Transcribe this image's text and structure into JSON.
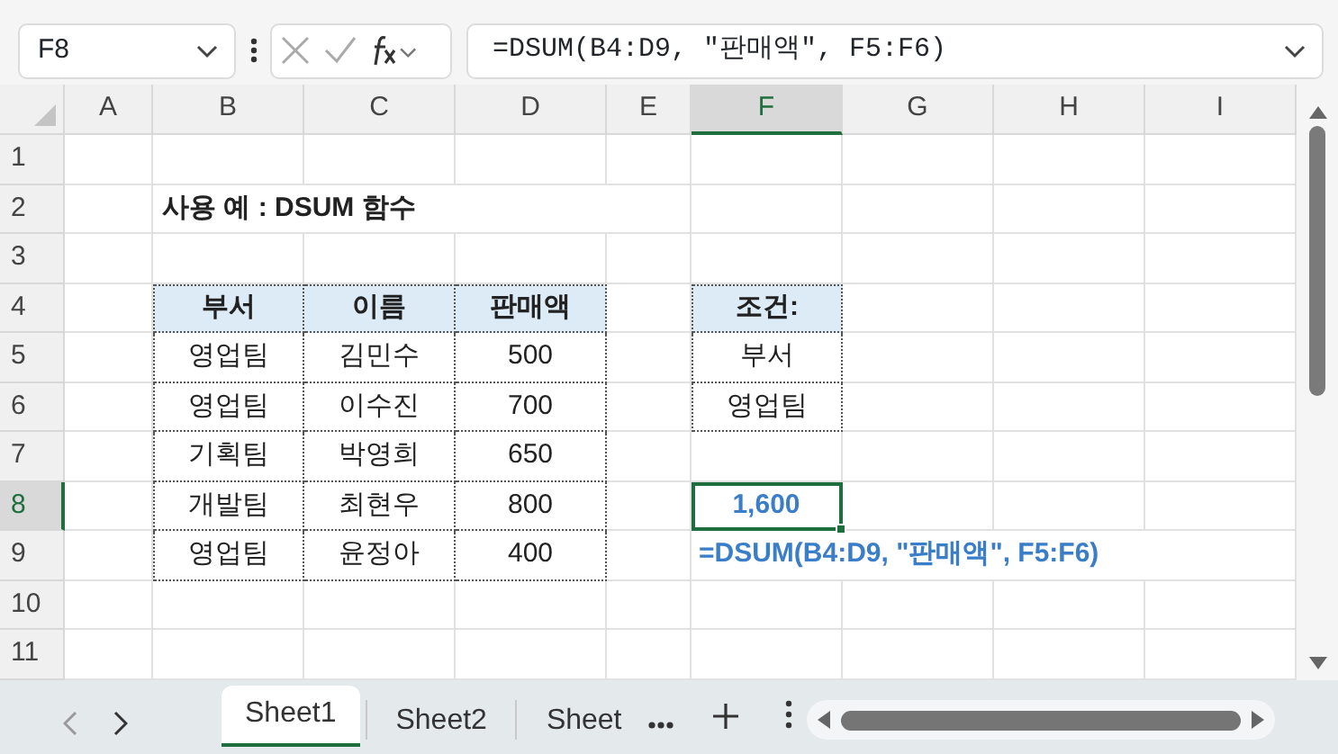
{
  "name_box": {
    "value": "F8"
  },
  "formula_bar": {
    "value": "=DSUM(B4:D9, \"판매액\", F5:F6)"
  },
  "columns": [
    {
      "label": "A",
      "selected": false
    },
    {
      "label": "B",
      "selected": false
    },
    {
      "label": "C",
      "selected": false
    },
    {
      "label": "D",
      "selected": false
    },
    {
      "label": "E",
      "selected": false
    },
    {
      "label": "F",
      "selected": true
    },
    {
      "label": "G",
      "selected": false
    },
    {
      "label": "H",
      "selected": false
    },
    {
      "label": "I",
      "selected": false
    }
  ],
  "rows": [
    {
      "label": "1",
      "selected": false
    },
    {
      "label": "2",
      "selected": false
    },
    {
      "label": "3",
      "selected": false
    },
    {
      "label": "4",
      "selected": false
    },
    {
      "label": "5",
      "selected": false
    },
    {
      "label": "6",
      "selected": false
    },
    {
      "label": "7",
      "selected": false
    },
    {
      "label": "8",
      "selected": true
    },
    {
      "label": "9",
      "selected": false
    },
    {
      "label": "10",
      "selected": false
    },
    {
      "label": "11",
      "selected": false
    }
  ],
  "title": "사용 예 : DSUM 함수",
  "sales_table": {
    "columns": [
      "부서",
      "이름",
      "판매액"
    ],
    "rows": [
      [
        "영업팀",
        "김민수",
        "500"
      ],
      [
        "영업팀",
        "이수진",
        "700"
      ],
      [
        "기획팀",
        "박영희",
        "650"
      ],
      [
        "개발팀",
        "최현우",
        "800"
      ],
      [
        "영업팀",
        "윤정아",
        "400"
      ]
    ]
  },
  "criteria": {
    "heading": "조건:",
    "field": "부서",
    "value": "영업팀"
  },
  "result": {
    "text": "1,600",
    "selected": true
  },
  "formula_note": "=DSUM(B4:D9, \"판매액\", F5:F6)",
  "sheets": [
    {
      "label": "Sheet1",
      "selected": true
    },
    {
      "label": "Sheet2",
      "selected": false
    },
    {
      "label": "Sheet",
      "selected": false
    }
  ]
}
